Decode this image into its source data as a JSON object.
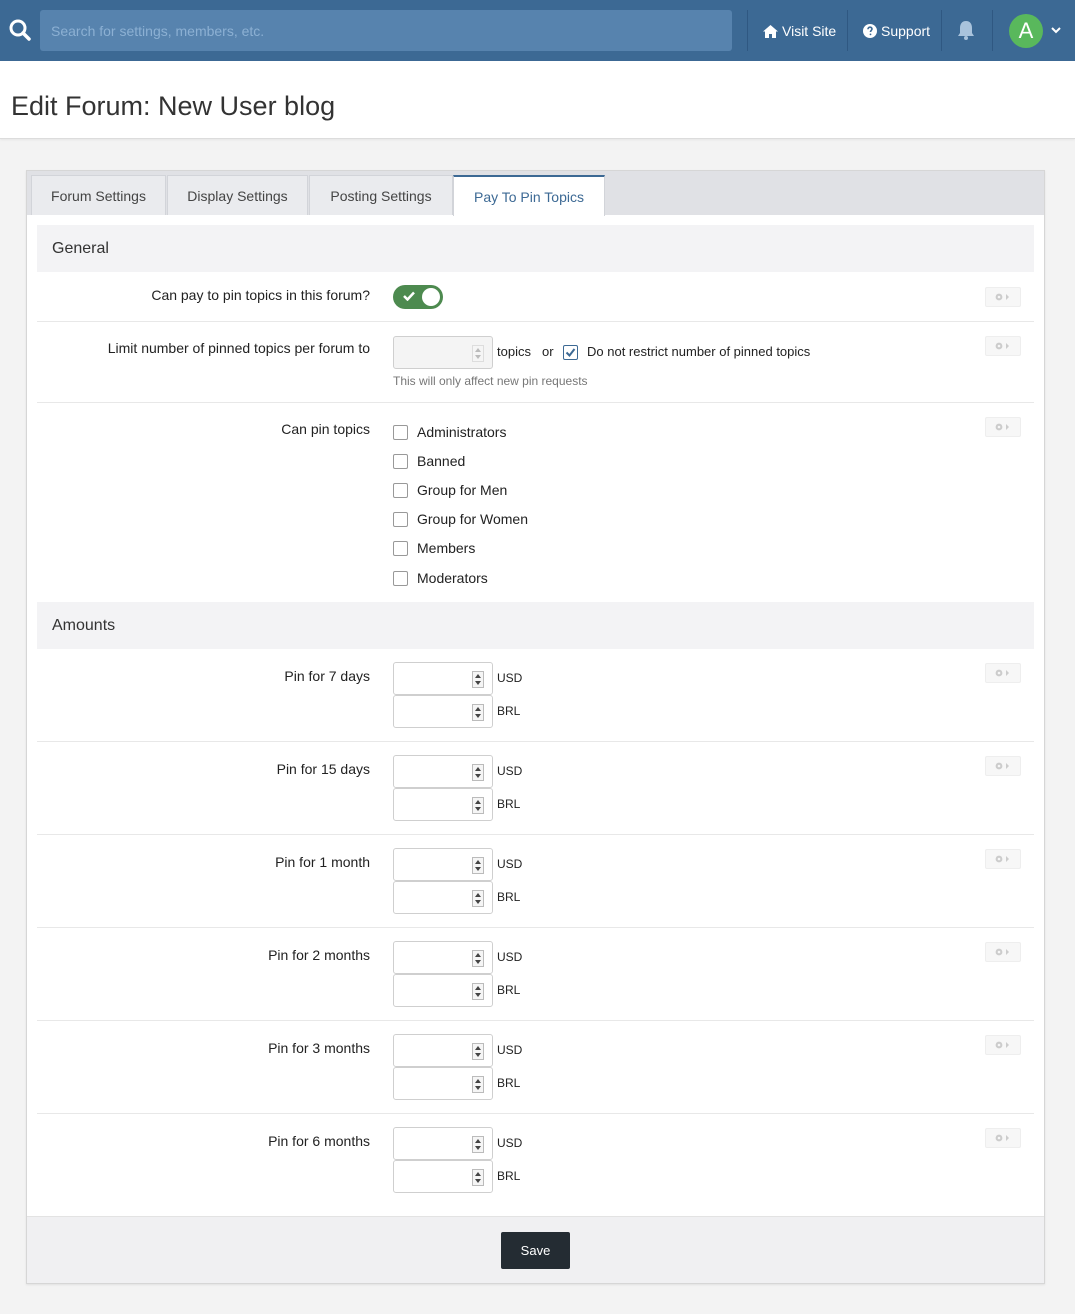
{
  "topbar": {
    "search_placeholder": "Search for settings, members, etc.",
    "visit_site": "Visit Site",
    "support": "Support",
    "avatar_letter": "A"
  },
  "page_title": "Edit Forum: New User blog",
  "tabs": [
    {
      "label": "Forum Settings"
    },
    {
      "label": "Display Settings"
    },
    {
      "label": "Posting Settings"
    },
    {
      "label": "Pay To Pin Topics",
      "active": true
    }
  ],
  "general": {
    "heading": "General",
    "can_pay_label": "Can pay to pin topics in this forum?",
    "can_pay_enabled": true,
    "limit_label": "Limit number of pinned topics per forum to",
    "limit_suffix": "topics",
    "limit_or": "or",
    "no_restrict_label": "Do not restrict number of pinned topics",
    "no_restrict_checked": true,
    "limit_hint": "This will only affect new pin requests",
    "can_pin_label": "Can pin topics",
    "groups": [
      {
        "label": "Administrators",
        "checked": false
      },
      {
        "label": "Banned",
        "checked": false
      },
      {
        "label": "Group for Men",
        "checked": false
      },
      {
        "label": "Group for Women",
        "checked": false
      },
      {
        "label": "Members",
        "checked": false
      },
      {
        "label": "Moderators",
        "checked": false
      }
    ]
  },
  "amounts": {
    "heading": "Amounts",
    "currencies": [
      "USD",
      "BRL"
    ],
    "rows": [
      {
        "label": "Pin for 7 days"
      },
      {
        "label": "Pin for 15 days"
      },
      {
        "label": "Pin for 1 month"
      },
      {
        "label": "Pin for 2 months"
      },
      {
        "label": "Pin for 3 months"
      },
      {
        "label": "Pin for 6 months"
      }
    ]
  },
  "footer": {
    "save_label": "Save"
  },
  "colors": {
    "topbar": "#3c6994",
    "toggle_on": "#4d8a4f",
    "avatar": "#59b85c",
    "save_button": "#242c33"
  }
}
